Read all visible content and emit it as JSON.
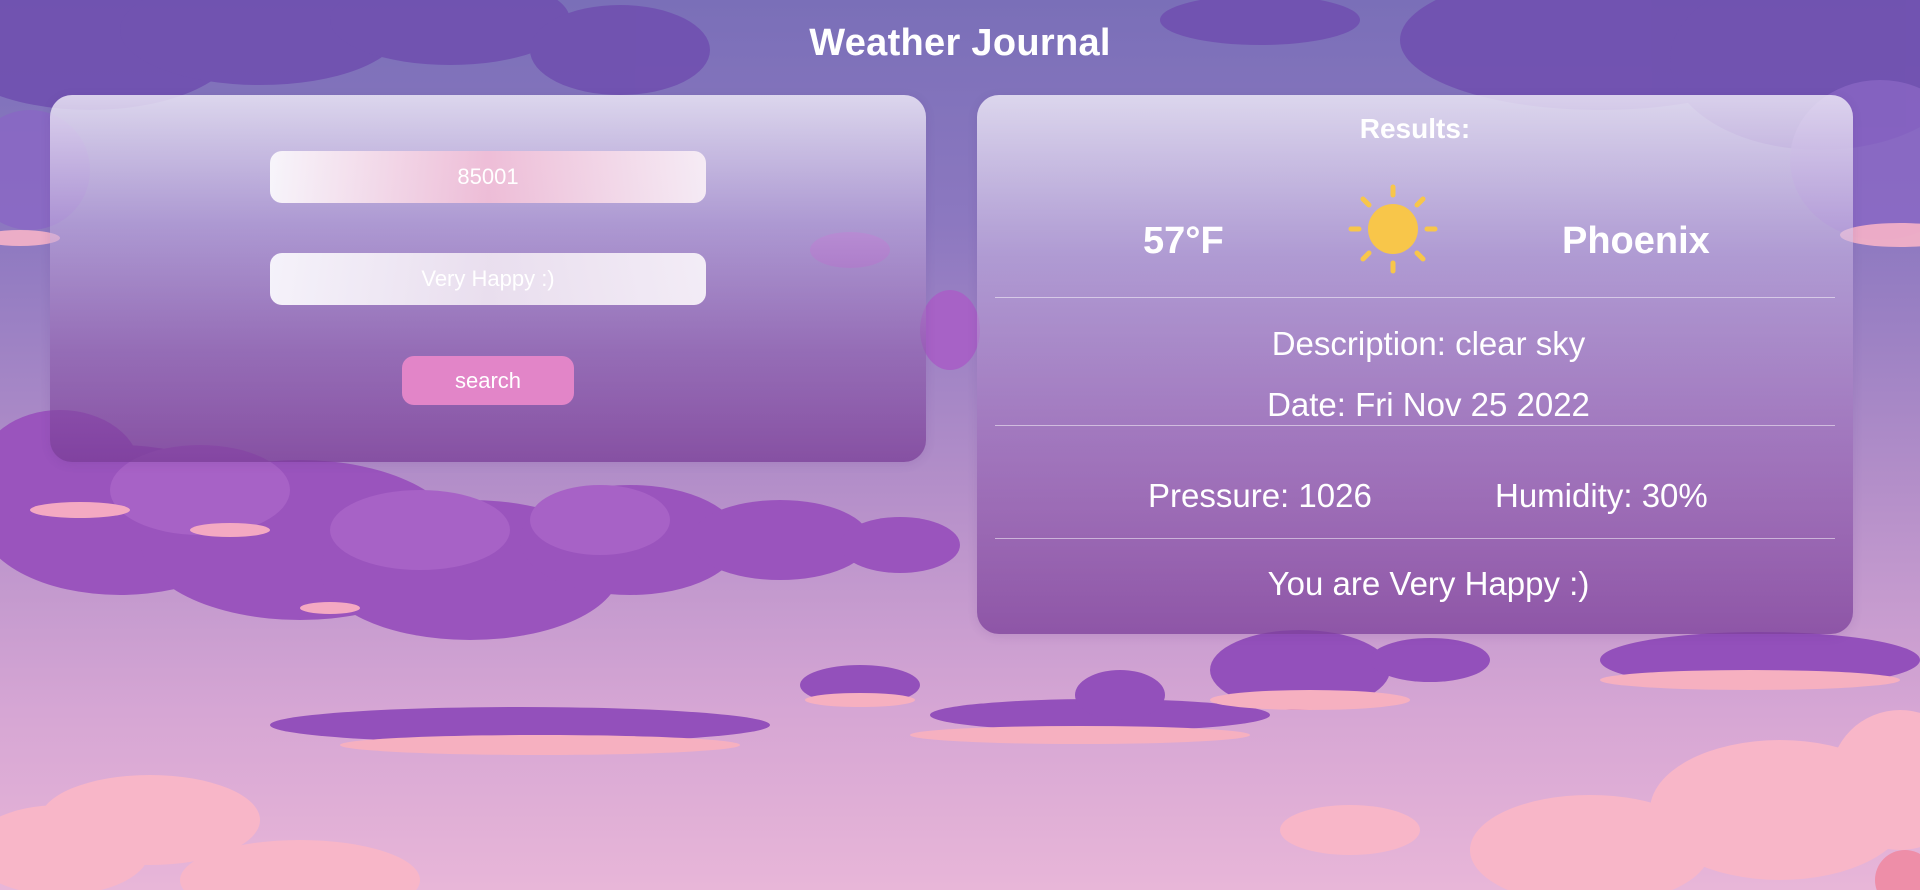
{
  "header": {
    "title": "Weather Journal"
  },
  "form": {
    "zip_value": "85001",
    "feelings_value": "Very Happy :)",
    "search_label": "search"
  },
  "results": {
    "title": "Results:",
    "temperature": "57°F",
    "weather_icon": "sun-icon",
    "city": "Phoenix",
    "description": "Description: clear sky",
    "date": "Date: Fri Nov 25 2022",
    "pressure": "Pressure: 1026",
    "humidity": "Humidity: 30%",
    "feeling": "You are Very Happy :)"
  },
  "colors": {
    "button": "#e285c8",
    "sun": "#f8c64a",
    "text": "#ffffff"
  }
}
